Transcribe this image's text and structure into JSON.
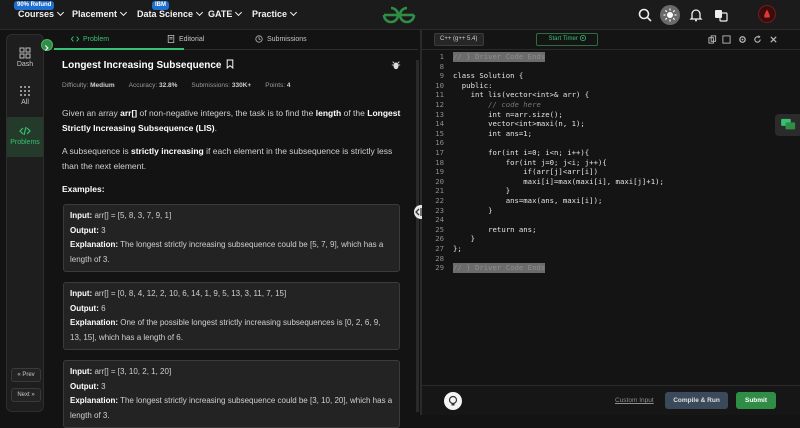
{
  "topbar": {
    "refund_badge": "90% Refund",
    "ibm_badge": "IBM",
    "nav": [
      "Courses",
      "Placement",
      "Data Science",
      "GATE",
      "Practice"
    ]
  },
  "sidebar": {
    "items": [
      "Dash",
      "All",
      "Problems"
    ],
    "prev": "« Prev",
    "next": "Next »"
  },
  "tabs": [
    "Problem",
    "Editorial",
    "Submissions"
  ],
  "problem": {
    "title": "Longest Increasing Subsequence",
    "difficulty_label": "Difficulty:",
    "difficulty": "Medium",
    "accuracy_label": "Accuracy:",
    "accuracy": "32.8%",
    "submissions_label": "Submissions:",
    "submissions": "330K+",
    "points_label": "Points:",
    "points": "4",
    "desc1_a": "Given an array ",
    "desc1_b": "arr[]",
    "desc1_c": " of non-negative integers, the task is to find the ",
    "desc1_d": "length",
    "desc1_e": " of the ",
    "desc1_f": "Longest Strictly Increasing Subsequence (LIS)",
    "desc1_g": ".",
    "desc2_a": "A subsequence is ",
    "desc2_b": "strictly increasing",
    "desc2_c": " if each element in the subsequence is strictly less than the next element.",
    "examples_heading": "Examples:",
    "input_label": "Input:",
    "output_label": "Output:",
    "explanation_label": "Explanation:",
    "examples": [
      {
        "input": "arr[] = [5, 8, 3, 7, 9, 1]",
        "output": "3",
        "explanation": "The longest strictly increasing subsequence could be [5, 7, 9], which has a length of 3."
      },
      {
        "input": "arr[] = [0, 8, 4, 12, 2, 10, 6, 14, 1, 9, 5, 13, 3, 11, 7, 15]",
        "output": "6",
        "explanation": "One of the possible longest strictly increasing subsequences is [0, 2, 6, 9, 13, 15], which has a length of 6."
      },
      {
        "input": "arr[] = [3, 10, 2, 1, 20]",
        "output": "3",
        "explanation": "The longest strictly increasing subsequence could be [3, 10, 20], which has a length of 3."
      }
    ]
  },
  "editor": {
    "language": "C++ (g++ 5.4)",
    "timer_label": "Start Timer",
    "custom_input": "Custom Input",
    "compile_run": "Compile & Run",
    "submit": "Submit",
    "lines": [
      {
        "n": "1",
        "t": "// } Driver Code Ends"
      },
      {
        "n": "8",
        "t": ""
      },
      {
        "n": "9",
        "t": "class Solution {"
      },
      {
        "n": "10",
        "t": "  public:"
      },
      {
        "n": "11",
        "t": "    int lis(vector<int>& arr) {"
      },
      {
        "n": "12",
        "t": "        // code here"
      },
      {
        "n": "13",
        "t": "        int n=arr.size();"
      },
      {
        "n": "14",
        "t": "        vector<int>maxi(n, 1);"
      },
      {
        "n": "15",
        "t": "        int ans=1;"
      },
      {
        "n": "16",
        "t": ""
      },
      {
        "n": "17",
        "t": "        for(int i=0; i<n; i++){"
      },
      {
        "n": "18",
        "t": "            for(int j=0; j<i; j++){"
      },
      {
        "n": "19",
        "t": "                if(arr[j]<arr[i])"
      },
      {
        "n": "20",
        "t": "                maxi[i]=max(maxi[i], maxi[j]+1);"
      },
      {
        "n": "21",
        "t": "            }"
      },
      {
        "n": "22",
        "t": "            ans=max(ans, maxi[i]);"
      },
      {
        "n": "23",
        "t": "        }"
      },
      {
        "n": "24",
        "t": ""
      },
      {
        "n": "25",
        "t": "        return ans;"
      },
      {
        "n": "26",
        "t": "    }"
      },
      {
        "n": "27",
        "t": "};"
      },
      {
        "n": "28",
        "t": ""
      },
      {
        "n": "29",
        "t": "// } Driver Code Ends"
      }
    ]
  },
  "colors": {
    "accent": "#2f8d46",
    "background": "#131313"
  }
}
